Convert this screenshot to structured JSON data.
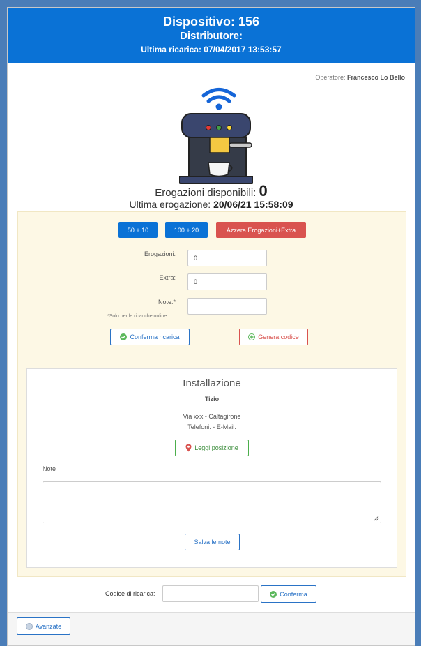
{
  "header": {
    "title": "Dispositivo: 156",
    "subtitle": "Distributore:",
    "last_recharge": "Ultima ricarica: 07/04/2017 13:53:57"
  },
  "operator": {
    "label": "Operatore:",
    "name": "Francesco Lo Bello"
  },
  "stats": {
    "available_label": "Erogazioni disponibili:",
    "available_value": "0",
    "last_label": "Ultima erogazione:",
    "last_value": "20/06/21 15:58:09"
  },
  "recharge": {
    "preset_1": "50 + 10",
    "preset_2": "100 + 20",
    "reset_label": "Azzera Erogazioni+Extra",
    "erogazioni_label": "Erogazioni:",
    "erogazioni_value": "0",
    "extra_label": "Extra:",
    "extra_value": "0",
    "note_label": "Note:*",
    "note_value": "",
    "note_hint": "*Solo per le ricariche online",
    "confirm_label": "Conferma ricarica",
    "generate_label": "Genera codice"
  },
  "installation": {
    "title": "Installazione",
    "name": "Tizio",
    "address": "Via xxx - Caltagirone",
    "contacts": "Telefoni: - E-Mail:",
    "position_button": "Leggi posizione",
    "notes_label": "Note",
    "save_button": "Salva le note"
  },
  "code": {
    "label": "Codice di ricarica:",
    "value": "",
    "confirm_label": "Conferma"
  },
  "footer": {
    "advanced_label": "Avanzate"
  },
  "colors": {
    "header_bg": "#0a72d6",
    "primary": "#0a72d6",
    "danger": "#d9534f",
    "success": "#4cae4c",
    "panel_bg": "#fdf8e5"
  },
  "icons": {
    "wifi": "wifi-icon",
    "machine": "coffee-machine-icon",
    "check": "check-circle-icon",
    "plus": "plus-circle-icon",
    "pin": "map-pin-icon",
    "advanced": "gear-circle-icon"
  }
}
